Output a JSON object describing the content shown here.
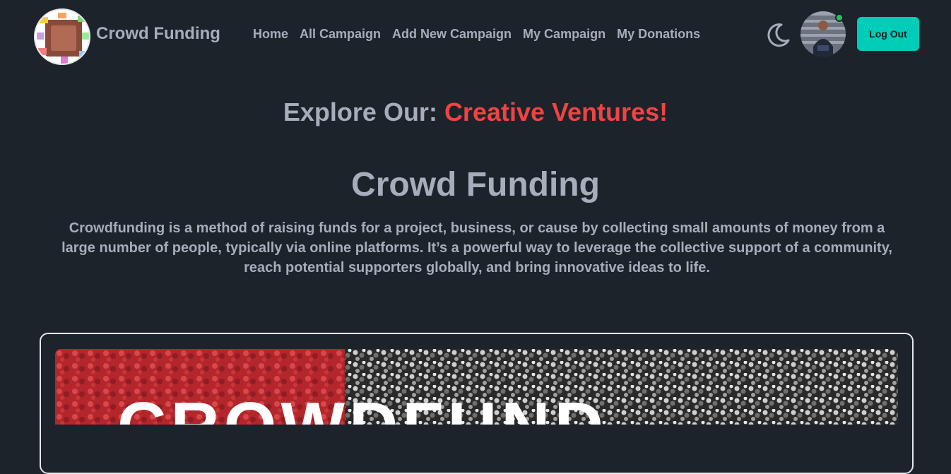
{
  "brand": {
    "name": "Crowd Funding"
  },
  "nav": {
    "links": [
      {
        "label": "Home"
      },
      {
        "label": "All Campaign"
      },
      {
        "label": "Add New Campaign"
      },
      {
        "label": "My Campaign"
      },
      {
        "label": "My Donations"
      }
    ]
  },
  "header_actions": {
    "logout_label": "Log Out"
  },
  "headline": {
    "prefix": "Explore Our: ",
    "accent": "Creative Ventures!"
  },
  "hero": {
    "title": "Crowd Funding",
    "description": "Crowdfunding is a method of raising funds for a project, business, or cause by collecting small amounts of money from a large number of people, typically via online platforms. It’s a powerful way to leverage the collective support of a community, reach potential supporters globally, and bring innovative ideas to life."
  },
  "banner": {
    "overlay_text": "CROWDFUND"
  },
  "colors": {
    "background": "#1d232a",
    "text": "#a6adbb",
    "accent_red": "#ef4444",
    "button_teal": "#00cdb7",
    "online_green": "#22c55e"
  }
}
